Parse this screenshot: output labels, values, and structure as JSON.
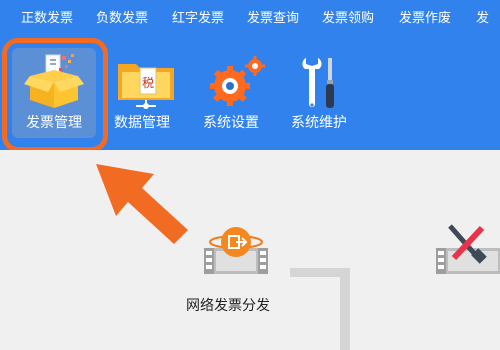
{
  "menu": {
    "items": [
      {
        "label": "正数发票"
      },
      {
        "label": "负数发票"
      },
      {
        "label": "红字发票"
      },
      {
        "label": "发票查询"
      },
      {
        "label": "发票领购"
      },
      {
        "label": "发票作废"
      }
    ],
    "overflow_label": "发"
  },
  "toolbar": {
    "items": [
      {
        "label": "发票管理",
        "icon": "invoice-box-icon",
        "selected": true
      },
      {
        "label": "数据管理",
        "icon": "folder-data-icon"
      },
      {
        "label": "系统设置",
        "icon": "gear-settings-icon"
      },
      {
        "label": "系统维护",
        "icon": "wrench-screwdriver-icon"
      }
    ]
  },
  "content": {
    "features": [
      {
        "label": "网络发票分发",
        "icon": "network-dispatch-icon"
      },
      {
        "label": "",
        "icon": "tools-film-icon"
      }
    ]
  },
  "annotation": {
    "highlight_color": "#f26b22",
    "arrow_color": "#f26b22"
  },
  "colors": {
    "topbar": "#3182ec",
    "selected_tool_bg": "#5b8fd6",
    "content_bg": "#f0f0f0"
  }
}
